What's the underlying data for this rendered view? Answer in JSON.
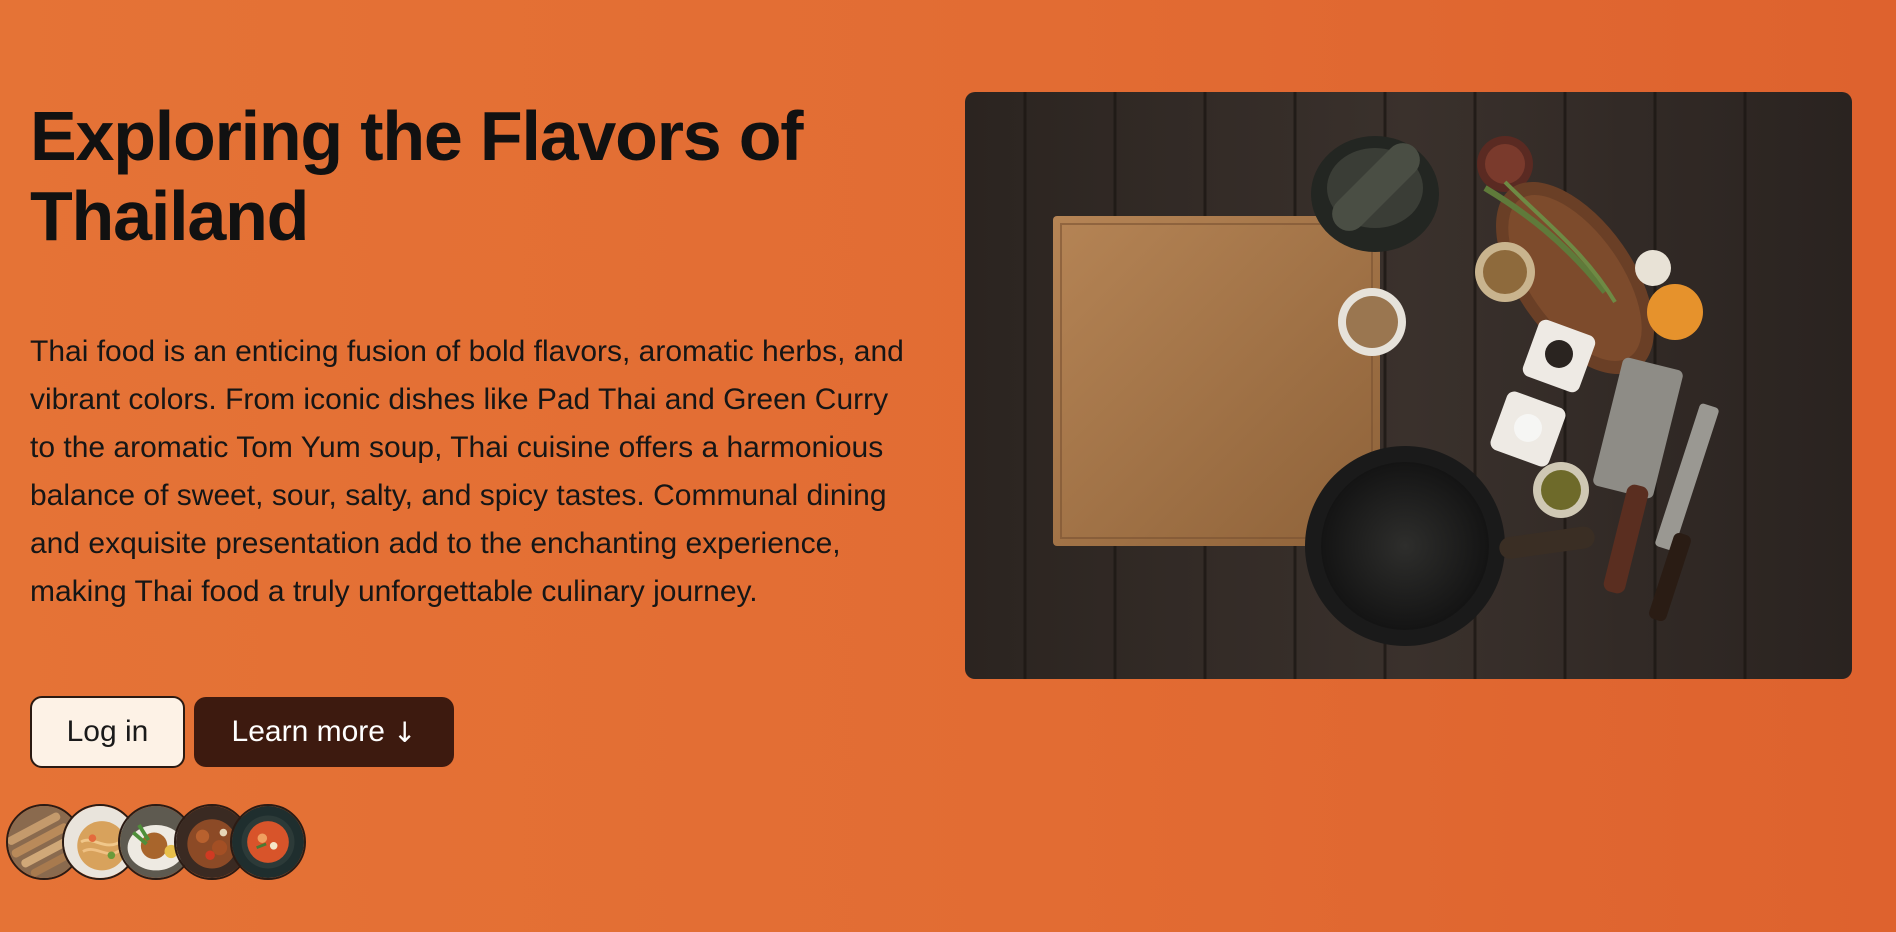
{
  "hero": {
    "title": "Exploring the Flavors of Thailand",
    "description": "Thai food is an enticing fusion of bold flavors, aromatic herbs, and vibrant colors. From iconic dishes like Pad Thai and Green Curry to the aromatic Tom Yum soup, Thai cuisine offers a harmonious balance of sweet, sour, salty, and spicy tastes. Communal dining and exquisite presentation add to the enchanting experience, making Thai food a truly unforgettable culinary journey.",
    "login_label": "Log in",
    "learn_more_label": "Learn more",
    "learn_more_icon": "arrow-down-icon",
    "learn_more_arrow": "↓"
  },
  "thumbnails": [
    {
      "name": "spring-rolls",
      "icon": "spring-rolls-thumbnail"
    },
    {
      "name": "pad-thai",
      "icon": "pad-thai-thumbnail"
    },
    {
      "name": "grilled-dish",
      "icon": "grilled-dish-thumbnail"
    },
    {
      "name": "spicy-salad",
      "icon": "spicy-salad-thumbnail"
    },
    {
      "name": "tom-yum",
      "icon": "tom-yum-thumbnail"
    }
  ],
  "colors": {
    "background_start": "#e57336",
    "background_end": "#de622e",
    "login_bg": "#fdf2e6",
    "learn_more_bg": "#3d1a0f",
    "text": "#111111"
  }
}
